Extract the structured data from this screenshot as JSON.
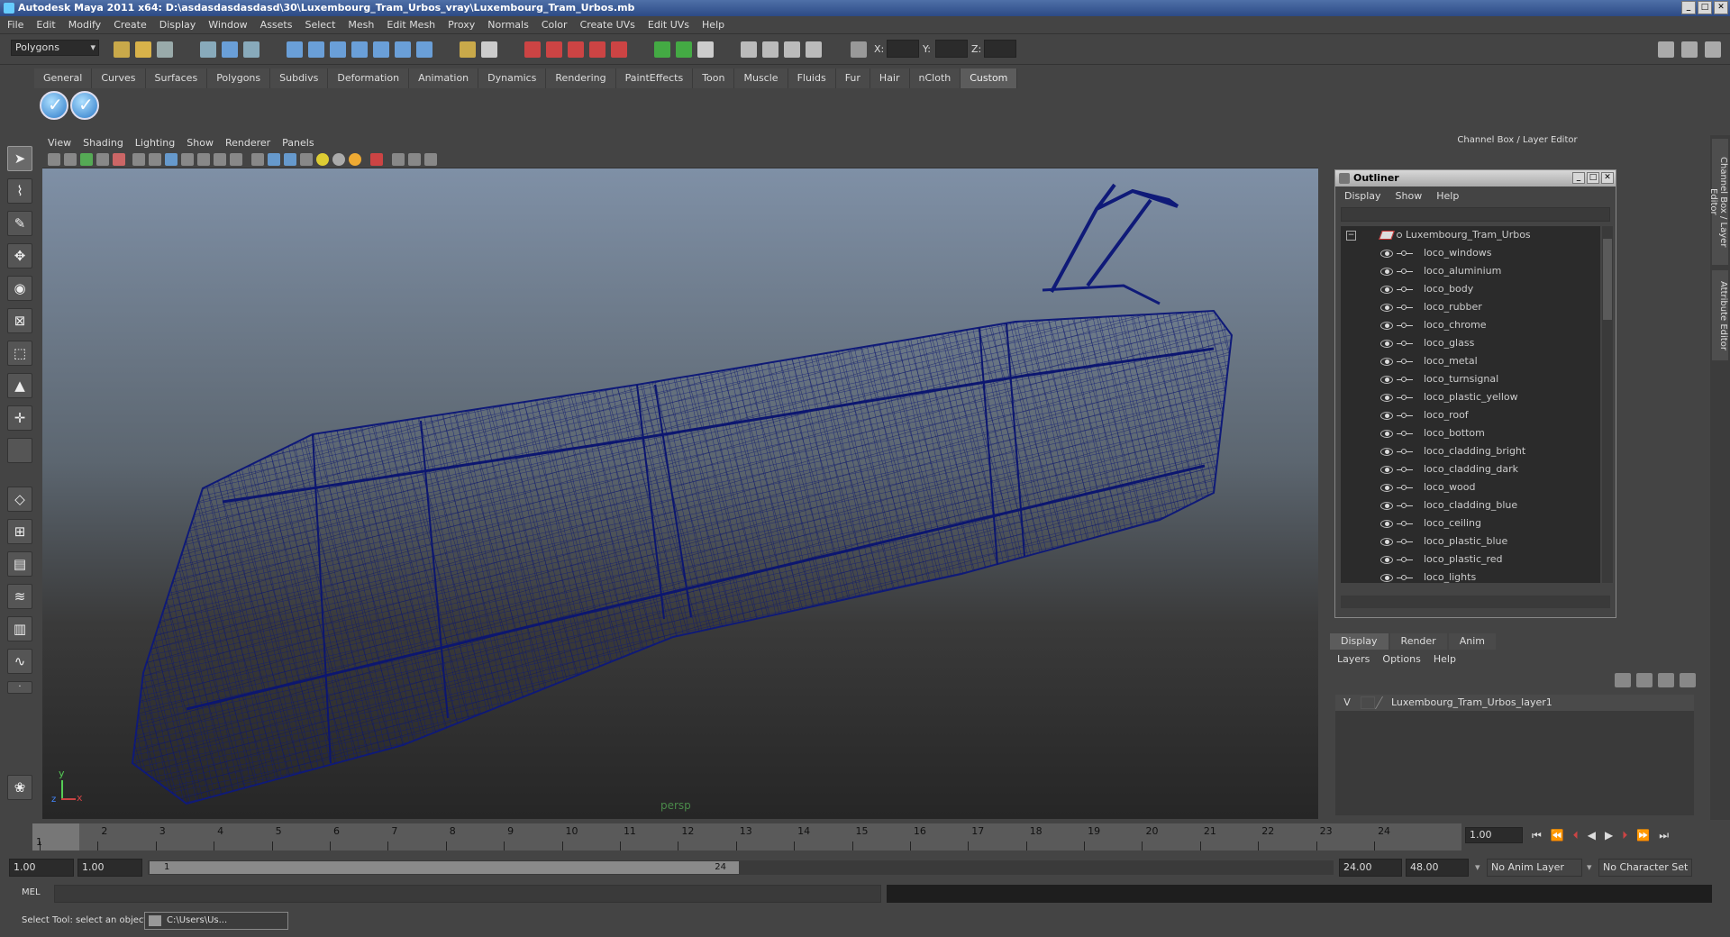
{
  "window": {
    "title": "Autodesk Maya 2011 x64: D:\\asdasdasdasdasd\\30\\Luxembourg_Tram_Urbos_vray\\Luxembourg_Tram_Urbos.mb"
  },
  "menubar": [
    "File",
    "Edit",
    "Modify",
    "Create",
    "Display",
    "Window",
    "Assets",
    "Select",
    "Mesh",
    "Edit Mesh",
    "Proxy",
    "Normals",
    "Color",
    "Create UVs",
    "Edit UVs",
    "Help"
  ],
  "status": {
    "mode": "Polygons",
    "x_label": "X:",
    "y_label": "Y:",
    "z_label": "Z:"
  },
  "shelf_tabs": [
    "General",
    "Curves",
    "Surfaces",
    "Polygons",
    "Subdivs",
    "Deformation",
    "Animation",
    "Dynamics",
    "Rendering",
    "PaintEffects",
    "Toon",
    "Muscle",
    "Fluids",
    "Fur",
    "Hair",
    "nCloth",
    "Custom"
  ],
  "active_shelf_tab": "Custom",
  "viewport": {
    "menu": [
      "View",
      "Shading",
      "Lighting",
      "Show",
      "Renderer",
      "Panels"
    ],
    "camera_label": "persp",
    "axis_y": "y",
    "axis_x": "x",
    "axis_z": "z",
    "wire_color": "#101a6e"
  },
  "channel_box": {
    "header": "Channel Box / Layer Editor"
  },
  "side_tabs": [
    "Channel Box / Layer Editor",
    "Attribute Editor"
  ],
  "outliner": {
    "title": "Outliner",
    "menu": [
      "Display",
      "Show",
      "Help"
    ],
    "root": "Luxembourg_Tram_Urbos",
    "items": [
      "loco_windows",
      "loco_aluminium",
      "loco_body",
      "loco_rubber",
      "loco_chrome",
      "loco_glass",
      "loco_metal",
      "loco_turnsignal",
      "loco_plastic_yellow",
      "loco_roof",
      "loco_bottom",
      "loco_cladding_bright",
      "loco_cladding_dark",
      "loco_wood",
      "loco_cladding_blue",
      "loco_ceiling",
      "loco_plastic_blue",
      "loco_plastic_red",
      "loco_lights"
    ]
  },
  "layer_editor": {
    "tabs": [
      "Display",
      "Render",
      "Anim"
    ],
    "menu": [
      "Layers",
      "Options",
      "Help"
    ],
    "layers": [
      {
        "visible": "V",
        "name": "Luxembourg_Tram_Urbos_layer1"
      }
    ]
  },
  "time_slider": {
    "ticks": [
      "1",
      "2",
      "3",
      "4",
      "5",
      "6",
      "7",
      "8",
      "9",
      "10",
      "11",
      "12",
      "13",
      "14",
      "15",
      "16",
      "17",
      "18",
      "19",
      "20",
      "21",
      "22",
      "23",
      "24"
    ],
    "current_frame_label": "1",
    "current_time": "1.00"
  },
  "range_slider": {
    "start": "1.00",
    "anim_start": "1.00",
    "range_start_label": "1",
    "range_end_label": "24",
    "anim_end": "24.00",
    "end": "48.00",
    "anim_layer": "No Anim Layer",
    "character_set": "No Character Set"
  },
  "command_line": {
    "label": "MEL"
  },
  "help_line": {
    "text": "Select Tool: select an object",
    "task_button": "C:\\Users\\Us..."
  }
}
